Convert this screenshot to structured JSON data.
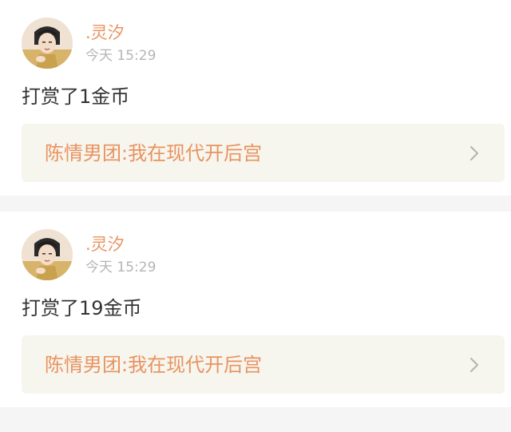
{
  "posts": [
    {
      "username": ".灵汐",
      "time": "今天 15:29",
      "message": "打赏了1金币",
      "book_title": "陈情男团:我在现代开后宫"
    },
    {
      "username": ".灵汐",
      "time": "今天 15:29",
      "message": "打赏了19金币",
      "book_title": "陈情男团:我在现代开后宫"
    }
  ],
  "colors": {
    "accent": "#e9935f",
    "muted": "#b5b5b5",
    "text": "#333333",
    "link_bg": "#f6f5ee",
    "separator": "#f5f5f5"
  },
  "icons": {
    "avatar": "user-avatar-illustration",
    "chevron": "chevron-right-icon"
  }
}
